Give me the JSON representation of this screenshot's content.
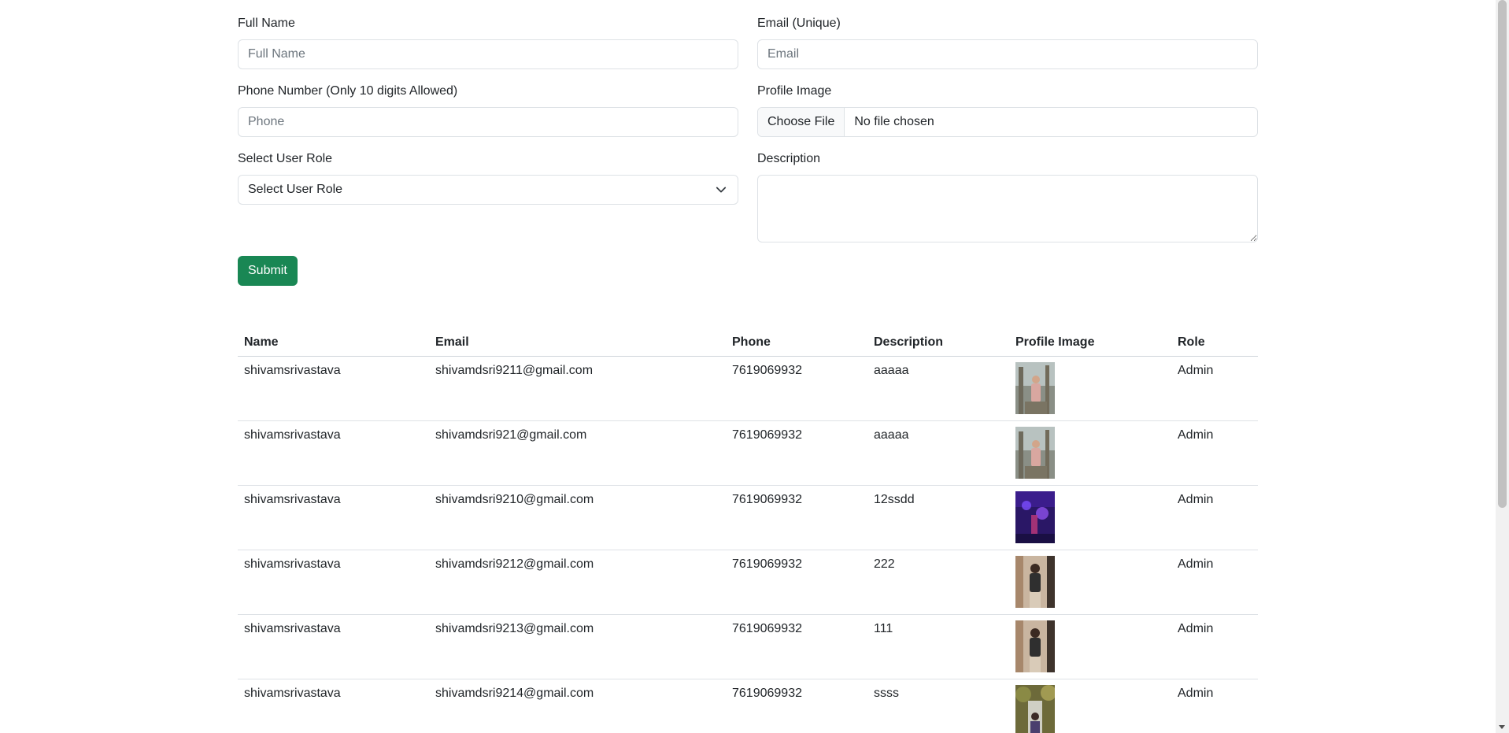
{
  "form": {
    "full_name": {
      "label": "Full Name",
      "placeholder": "Full Name"
    },
    "email": {
      "label": "Email (Unique)",
      "placeholder": "Email"
    },
    "phone": {
      "label": "Phone Number (Only 10 digits Allowed)",
      "placeholder": "Phone"
    },
    "profile_image": {
      "label": "Profile Image",
      "button": "Choose File",
      "status": "No file chosen"
    },
    "role": {
      "label": "Select User Role",
      "selected": "Select User Role"
    },
    "description": {
      "label": "Description"
    },
    "submit_label": "Submit",
    "accent_color": "#198754"
  },
  "table": {
    "headers": [
      "Name",
      "Email",
      "Phone",
      "Description",
      "Profile Image",
      "Role"
    ],
    "rows": [
      {
        "name": "shivamsrivastava",
        "email": "shivamdsri9211@gmail.com",
        "phone": "7619069932",
        "description": "aaaaa",
        "role": "Admin"
      },
      {
        "name": "shivamsrivastava",
        "email": "shivamdsri921@gmail.com",
        "phone": "7619069932",
        "description": "aaaaa",
        "role": "Admin"
      },
      {
        "name": "shivamsrivastava",
        "email": "shivamdsri9210@gmail.com",
        "phone": "7619069932",
        "description": "12ssdd",
        "role": "Admin"
      },
      {
        "name": "shivamsrivastava",
        "email": "shivamdsri9212@gmail.com",
        "phone": "7619069932",
        "description": "222",
        "role": "Admin"
      },
      {
        "name": "shivamsrivastava",
        "email": "shivamdsri9213@gmail.com",
        "phone": "7619069932",
        "description": "111",
        "role": "Admin"
      },
      {
        "name": "shivamsrivastava",
        "email": "shivamdsri9214@gmail.com",
        "phone": "7619069932",
        "description": "ssss",
        "role": "Admin"
      }
    ]
  }
}
